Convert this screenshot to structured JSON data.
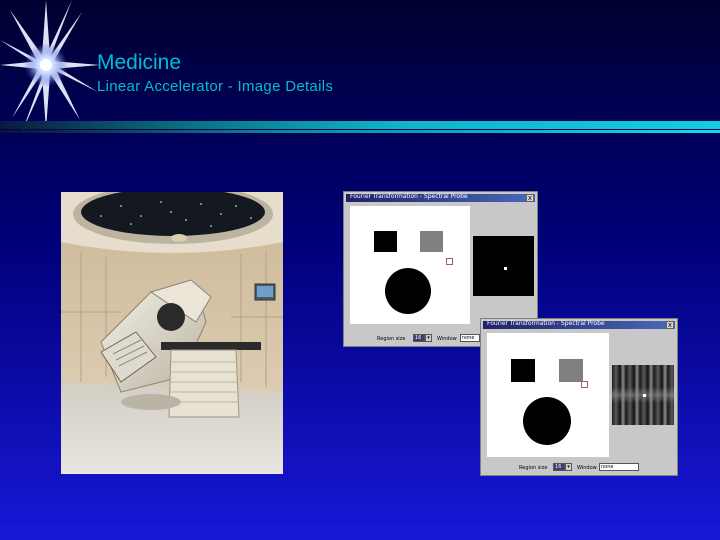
{
  "slide": {
    "title": "Medicine",
    "subtitle": "Linear Accelerator  -  Image Details"
  },
  "photo": {
    "description_icon": "linear-accelerator-photo"
  },
  "window1": {
    "title": "Fourier Transformation - Spectral Probe",
    "close_label": "x",
    "region_label": "Region size",
    "region_value": "16",
    "window_label": "Window",
    "window_value": "none"
  },
  "window2": {
    "title": "Fourier Transformation - Spectral Probe",
    "close_label": "x",
    "region_label": "Region size",
    "region_value": "16",
    "window_label": "Window",
    "window_value": "none"
  },
  "colors": {
    "title": "#00bcd6",
    "background_top": "#000030",
    "background_bottom": "#1818d8"
  }
}
